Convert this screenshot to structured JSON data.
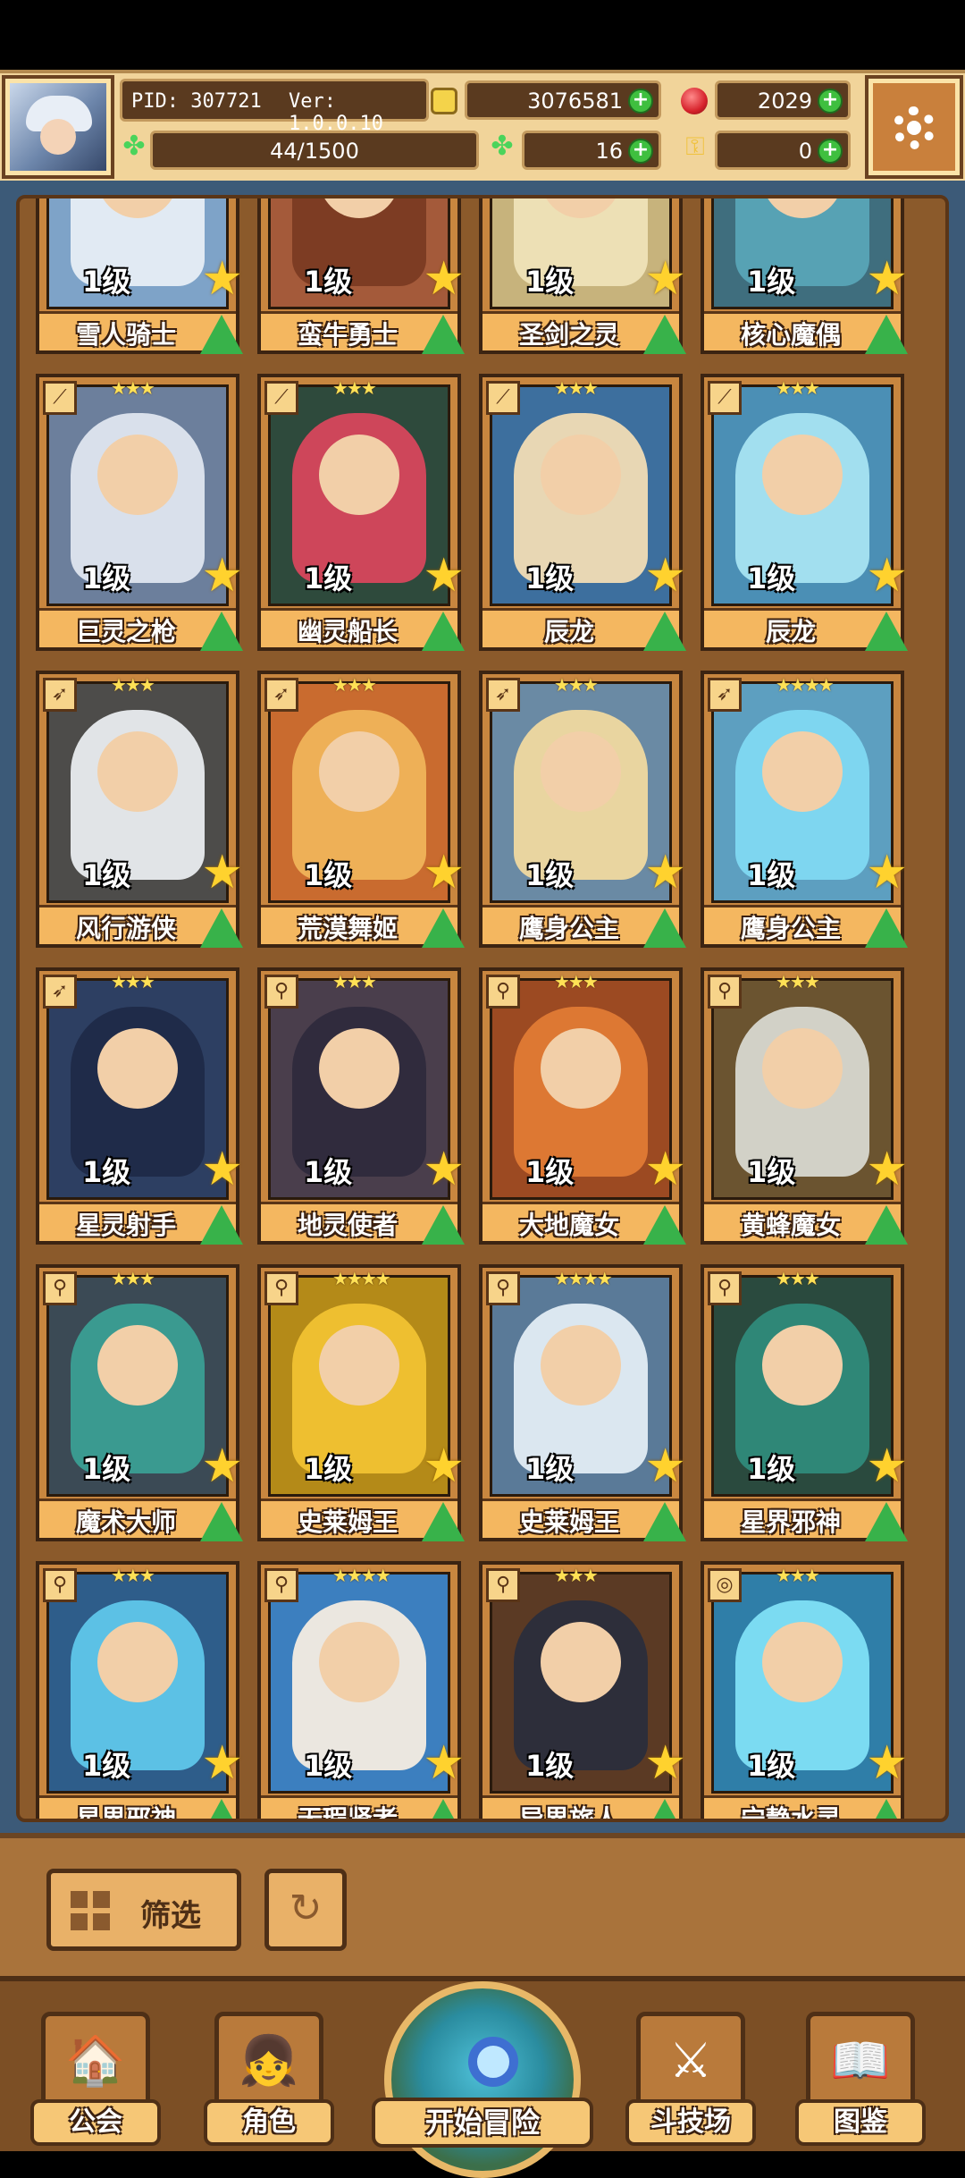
{
  "header": {
    "pid_label": "PID: 307721",
    "version_label": "Ver: 1.0.0.10",
    "gold": "3076581",
    "gems": "2029",
    "exp": "44/1500",
    "clover": "16",
    "keys": "0"
  },
  "colors": {
    "accent": "#f1d49a",
    "frame": "#8b5a2b",
    "plus": "#3fbf3f"
  },
  "cards": [
    {
      "name": "雪人骑士",
      "level": "1级",
      "art": "#7ea3c8",
      "hair": "#e7eef5",
      "type": "spear",
      "stars": "★★★"
    },
    {
      "name": "蛮牛勇士",
      "level": "1级",
      "art": "#a45a3a",
      "hair": "#7b3b22",
      "type": "sword",
      "stars": "★★★"
    },
    {
      "name": "圣剑之灵",
      "level": "1级",
      "art": "#c7b37c",
      "hair": "#efe3b8",
      "type": "sword",
      "stars": "★★★"
    },
    {
      "name": "核心魔偶",
      "level": "1级",
      "art": "#3f6e7e",
      "hair": "#58a4b7",
      "type": "staff",
      "stars": "★★★"
    },
    {
      "name": "巨灵之枪",
      "level": "1级",
      "art": "#6c7f9c",
      "hair": "#dfe6ef",
      "type": "spear",
      "stars": "★★★"
    },
    {
      "name": "幽灵船长",
      "level": "1级",
      "art": "#2e4a3c",
      "hair": "#d7465c",
      "type": "spear",
      "stars": "★★★"
    },
    {
      "name": "辰龙",
      "level": "1级",
      "art": "#3d6f9e",
      "hair": "#f1dcb5",
      "type": "spear",
      "stars": "★★★"
    },
    {
      "name": "辰龙",
      "level": "1级",
      "art": "#4b8fb5",
      "hair": "#a6e4f2",
      "type": "spear",
      "stars": "★★★"
    },
    {
      "name": "风行游侠",
      "level": "1级",
      "art": "#4d4c4a",
      "hair": "#e9ecef",
      "type": "bow",
      "stars": "★★★"
    },
    {
      "name": "荒漠舞姬",
      "level": "1级",
      "art": "#c96b2f",
      "hair": "#f0b45a",
      "type": "bow",
      "stars": "★★★"
    },
    {
      "name": "鹰身公主",
      "level": "1级",
      "art": "#6a8aa4",
      "hair": "#f0d9a0",
      "type": "bow",
      "stars": "★★★"
    },
    {
      "name": "鹰身公主",
      "level": "1级",
      "art": "#5d9fc0",
      "hair": "#7fd9f2",
      "type": "bow",
      "stars": "★★★★"
    },
    {
      "name": "星灵射手",
      "level": "1级",
      "art": "#2d3f62",
      "hair": "#1f2a48",
      "type": "bow",
      "stars": "★★★"
    },
    {
      "name": "地灵使者",
      "level": "1级",
      "art": "#4a3e4c",
      "hair": "#2e2a3c",
      "type": "staff",
      "stars": "★★★"
    },
    {
      "name": "大地魔女",
      "level": "1级",
      "art": "#9c4a22",
      "hair": "#e07a35",
      "type": "staff",
      "stars": "★★★"
    },
    {
      "name": "黄蜂魔女",
      "level": "1级",
      "art": "#6b5430",
      "hair": "#d8d8d0",
      "type": "staff",
      "stars": "★★★"
    },
    {
      "name": "魔术大师",
      "level": "1级",
      "art": "#3b4a55",
      "hair": "#3a9e93",
      "type": "staff",
      "stars": "★★★"
    },
    {
      "name": "史莱姆王",
      "level": "1级",
      "art": "#b48a18",
      "hair": "#f1c232",
      "type": "staff",
      "stars": "★★★★"
    },
    {
      "name": "史莱姆王",
      "level": "1级",
      "art": "#5a7a98",
      "hair": "#e3edf4",
      "type": "staff",
      "stars": "★★★★"
    },
    {
      "name": "星界邪神",
      "level": "1级",
      "art": "#2a4a3e",
      "hair": "#2f8a7a",
      "type": "staff",
      "stars": "★★★"
    },
    {
      "name": "星界邪神",
      "level": "1级",
      "art": "#2e5d8a",
      "hair": "#5fc6ea",
      "type": "staff",
      "stars": "★★★"
    },
    {
      "name": "无瑕贤者",
      "level": "1级",
      "art": "#3c7fbf",
      "hair": "#f4ede2",
      "type": "staff",
      "stars": "★★★★"
    },
    {
      "name": "异界旅人",
      "level": "1级",
      "art": "#5b3a24",
      "hair": "#2b2d3c",
      "type": "staff",
      "stars": "★★★"
    },
    {
      "name": "宁静水灵",
      "level": "1级",
      "art": "#2f7ea8",
      "hair": "#7fe0f5",
      "type": "orb",
      "stars": "★★★"
    }
  ],
  "filter": {
    "label": "筛选"
  },
  "nav": {
    "guild": "公会",
    "characters": "角色",
    "adventure": "开始冒险",
    "arena": "斗技场",
    "codex": "图鉴"
  }
}
